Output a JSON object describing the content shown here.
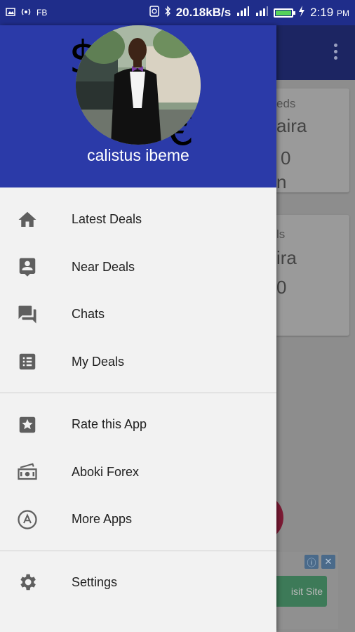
{
  "status_bar": {
    "left_indicators": [
      "image",
      "hotspot",
      "FB"
    ],
    "net_speed": "20.18kB/s",
    "time": "2:19",
    "time_suffix": "PM",
    "battery_fraction": 0.9,
    "battery_color": "#56d35a"
  },
  "drawer": {
    "header_color": "#2b3aa8",
    "user_name": "calistus ibeme",
    "header_glyphs": [
      "$",
      "€"
    ]
  },
  "menu_groups": [
    [
      {
        "label": "Latest Deals",
        "icon": "home-icon"
      },
      {
        "label": "Near Deals",
        "icon": "contact-card-icon"
      },
      {
        "label": "Chats",
        "icon": "chat-icon"
      },
      {
        "label": "My Deals",
        "icon": "list-icon"
      }
    ],
    [
      {
        "label": "Rate this App",
        "icon": "star-box-icon"
      },
      {
        "label": "Aboki Forex",
        "icon": "cash-icon"
      },
      {
        "label": "More Apps",
        "icon": "app-store-icon"
      }
    ],
    [
      {
        "label": "Settings",
        "icon": "gear-icon"
      }
    ]
  ],
  "background_app": {
    "cards": [
      {
        "line1": "eds",
        "line2": "aira",
        "line3": "0",
        "line4": "n"
      },
      {
        "line1": "ls",
        "line2": "ira",
        "line3": "0"
      }
    ],
    "ad_button": "isit Site",
    "ad_icons": [
      "ⓘ",
      "✕"
    ]
  }
}
